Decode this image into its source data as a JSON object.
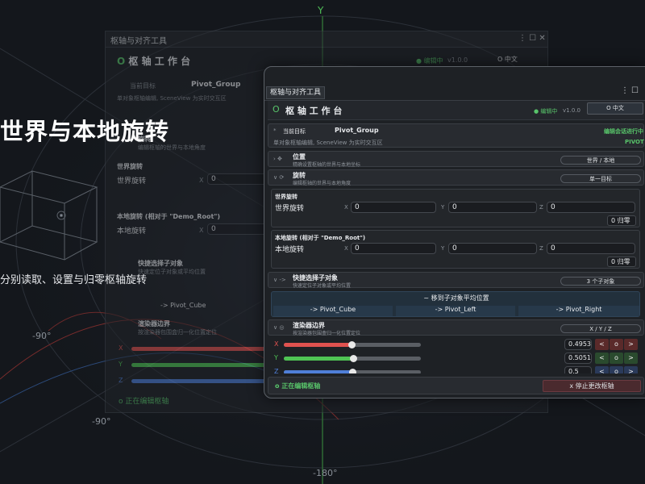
{
  "background": {
    "axis_labels": {
      "y": "Y",
      "neg90_a": "-90°",
      "neg90_b": "-90°",
      "neg180": "-180°"
    }
  },
  "hero": {
    "title": "世界与本地旋转",
    "subtitle": "分别读取、设置与归零枢轴旋转"
  },
  "back_window": {
    "tab": "枢轴与对齐工具",
    "title": "枢 轴 工 作 台",
    "status": "● 编辑中",
    "version": "v1.0.0",
    "lang": "O 中文",
    "target_label": "当前目标",
    "target_value": "Pivot_Group",
    "hint": "单对象枢轴编辑, SceneView 为实时交互区",
    "rotation_header": "旋转",
    "rotation_desc": "编辑枢轴的世界与本地角度",
    "world_rot_title": "世界旋转",
    "world_rot_label": "世界旋转",
    "world_rot_x": "0",
    "local_rot_title": "本地旋转 (相对于 \"Demo_Root\")",
    "local_rot_label": "本地旋转",
    "local_rot_x": "0",
    "quick_title": "快捷选择子对象",
    "quick_desc": "快速定位子对象或平均位置",
    "quick_btn": "-> Pivot_Cube",
    "bounds_title": "渲染器边界",
    "bounds_desc": "按渲染器包围盒归一化位置定位",
    "axes": [
      "X",
      "Y",
      "Z"
    ],
    "editing": "o 正在编辑枢轴"
  },
  "window": {
    "tab": "枢轴与对齐工具",
    "title_icon": "O",
    "title": "枢 轴 工 作 台",
    "status": "● 编辑中",
    "version": "v1.0.0",
    "lang_button": "O 中文",
    "target": {
      "label": "当前目标",
      "value": "Pivot_Group",
      "session": "编辑会话进行中",
      "hint": "单对象枢轴编辑, SceneView 为实时交互区",
      "pivot_badge": "PIVOT"
    },
    "position": {
      "icons": "› ✥",
      "title": "位置",
      "desc": "精确设置枢轴的世界与本地坐标",
      "button": "世界 / 本地"
    },
    "rotation": {
      "icons": "∨ ⟳",
      "title": "旋转",
      "desc": "编辑枢轴的世界与本地角度",
      "button": "单一目标",
      "world": {
        "title": "世界旋转",
        "label": "世界旋转",
        "x_label": "X",
        "x": "0",
        "y_label": "Y",
        "y": "0",
        "z_label": "Z",
        "z": "0",
        "reset": "0 归零"
      },
      "local": {
        "title": "本地旋转 (相对于 \"Demo_Root\")",
        "label": "本地旋转",
        "x_label": "X",
        "x": "0",
        "y_label": "Y",
        "y": "0",
        "z_label": "Z",
        "z": "0",
        "reset": "0 归零"
      }
    },
    "quick_select": {
      "icons": "∨ ->",
      "title": "快捷选择子对象",
      "desc": "快速定位子对象或平均位置",
      "button": "3 个子对象",
      "average": "~ 移到子对象平均位置",
      "children": [
        "-> Pivot_Cube",
        "-> Pivot_Left",
        "-> Pivot_Right"
      ]
    },
    "bounds": {
      "icons": "∨ ◎",
      "title": "渲染器边界",
      "desc": "按渲染器包围盒归一化位置定位",
      "button": "X / Y / Z",
      "sliders": [
        {
          "axis": "X",
          "value": 0.4953,
          "text": "0.4953",
          "color": "#e0524f"
        },
        {
          "axis": "Y",
          "value": 0.5051,
          "text": "0.5051",
          "color": "#4fc454"
        },
        {
          "axis": "Z",
          "value": 0.5,
          "text": "0.5",
          "color": "#4f7fd8"
        }
      ],
      "step_buttons": [
        "<",
        "o",
        ">"
      ]
    },
    "footer": {
      "editing": "o 正在编辑枢轴",
      "stop": "x 停止更改枢轴"
    }
  }
}
